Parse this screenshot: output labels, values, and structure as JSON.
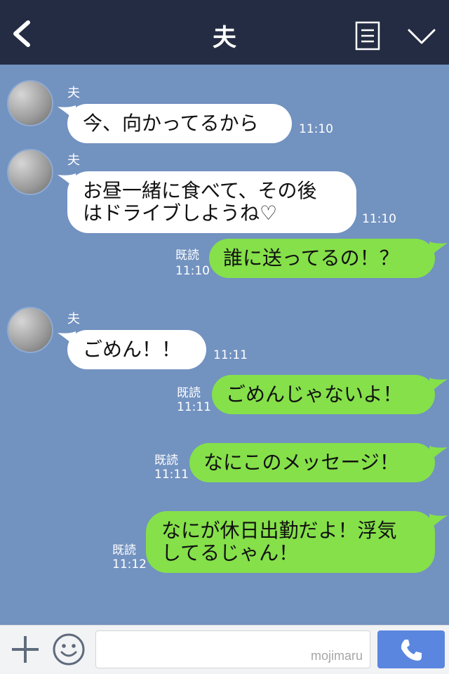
{
  "header": {
    "title": "夫"
  },
  "icons": {
    "back": "chevron-left-icon",
    "menu": "menu-list-icon",
    "collapse": "chevron-down-icon",
    "add": "plus-icon",
    "emoji": "smile-icon",
    "call": "phone-icon"
  },
  "messages": [
    {
      "dir": "in",
      "sender": "夫",
      "lines": [
        "今、向かってるから"
      ],
      "time": "11:10"
    },
    {
      "dir": "in",
      "sender": "夫",
      "lines": [
        "お昼一緒に食べて、その後",
        "はドライブしようね♡"
      ],
      "time": "11:10"
    },
    {
      "dir": "out",
      "read": "既読",
      "lines": [
        "誰に送ってるの！？"
      ],
      "time": "11:10"
    },
    {
      "dir": "in",
      "sender": "夫",
      "lines": [
        "ごめん！！"
      ],
      "time": "11:11"
    },
    {
      "dir": "out",
      "read": "既読",
      "lines": [
        "ごめんじゃないよ！"
      ],
      "time": "11:11"
    },
    {
      "dir": "out",
      "read": "既読",
      "lines": [
        "なにこのメッセージ！"
      ],
      "time": "11:11"
    },
    {
      "dir": "out",
      "read": "既読",
      "lines": [
        "なにが休日出勤だよ！浮気",
        "してるじゃん！"
      ],
      "time": "11:12"
    }
  ],
  "input": {
    "watermark": "mojimaru"
  },
  "colors": {
    "header_bg": "#232c42",
    "chat_bg": "#7292c0",
    "outgoing_bubble": "#85e04a",
    "incoming_bubble": "#ffffff",
    "call_button": "#5a86e0"
  }
}
